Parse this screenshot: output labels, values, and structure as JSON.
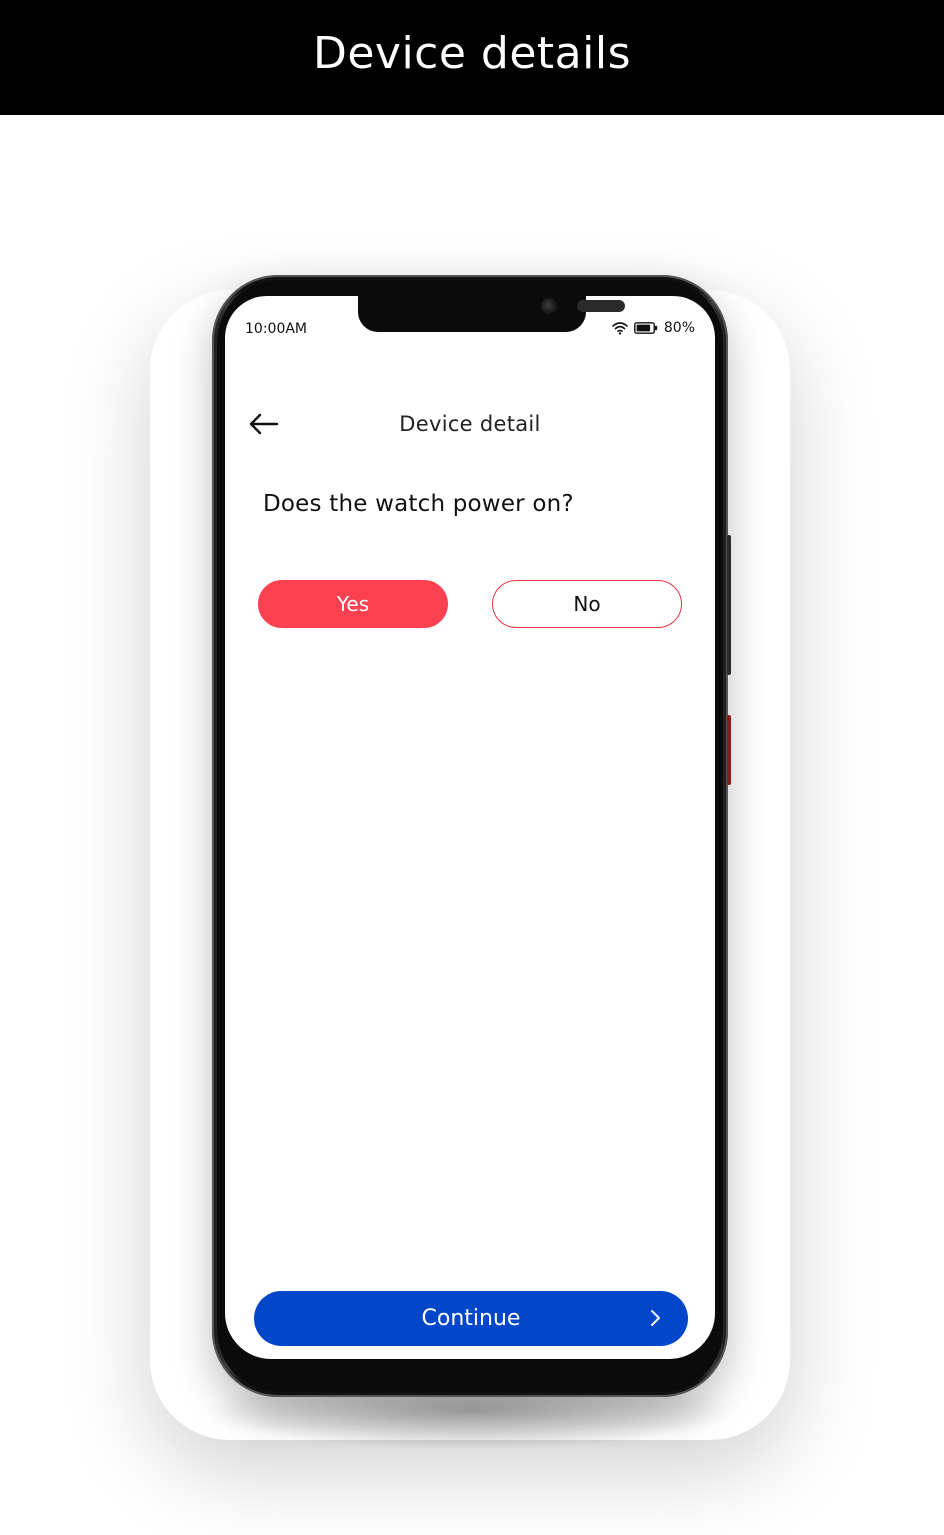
{
  "banner": {
    "title": "Device details"
  },
  "status_bar": {
    "time": "10:00AM",
    "battery": "80%",
    "icons": [
      "wifi-icon",
      "battery-icon"
    ]
  },
  "header": {
    "title": "Device detail",
    "back_icon": "arrow-left-icon"
  },
  "question": {
    "text": "Does the watch power on?"
  },
  "options": {
    "yes_label": "Yes",
    "no_label": "No",
    "selected": "Yes"
  },
  "footer": {
    "continue_label": "Continue",
    "continue_icon": "chevron-right-icon"
  },
  "colors": {
    "accent_red": "#fb4150",
    "primary_blue": "#0246c9",
    "banner_bg": "#000000"
  }
}
